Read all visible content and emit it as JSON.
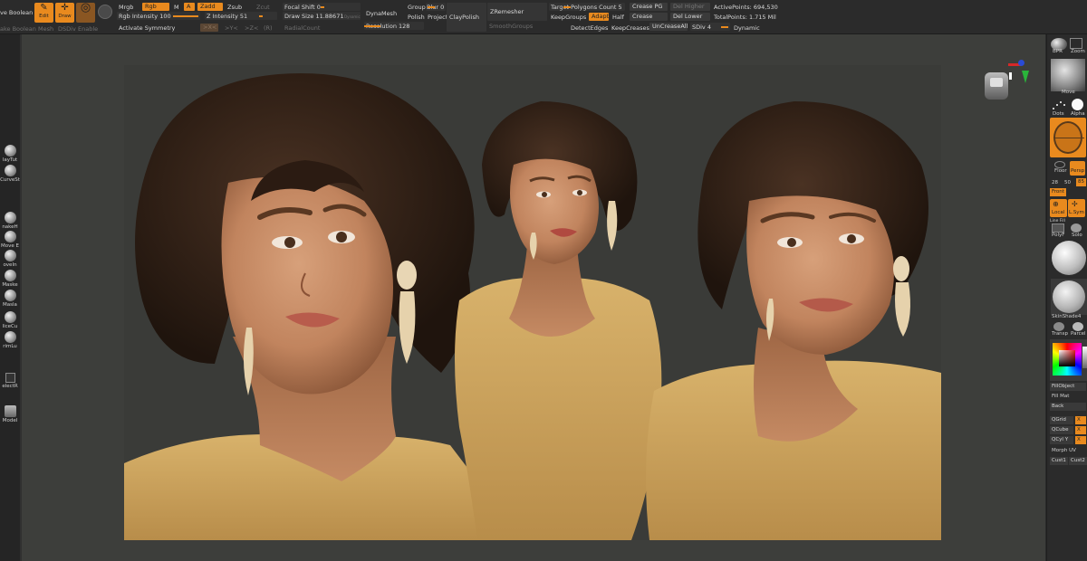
{
  "toolbar": {
    "live_boolean": "ve Boolean",
    "make_boolean_mesh": "ake Boolean Mesh",
    "dsdiv": "DSDiv",
    "enable": "Enable",
    "edit": "Edit",
    "draw": "Draw",
    "mrgb": "Mrgb",
    "rgb": "Rgb",
    "m": "M",
    "a": "A",
    "zadd": "Zadd",
    "zsub": "Zsub",
    "zcut": "Zcut",
    "rgb_intensity": "Rgb Intensity 100",
    "z_intensity": "Z Intensity 51",
    "activate_symmetry": "Activate Symmetry",
    "sym_x": ">X<",
    "sym_y": ">Y<",
    "sym_z": ">Z<",
    "sym_r": "(R)",
    "focal_shift": "Focal Shift 0",
    "draw_size": "Draw Size 11.88671",
    "dynamic_small": "Dynamic",
    "radial_count": "RadialCount",
    "dynamesh": "DynaMesh",
    "resolution": "Resolution 128",
    "groups": "Groups",
    "blur": "Blur 0",
    "polish": "Polish",
    "project": "Project",
    "claypolish": "ClayPolish",
    "zremesher": "ZRemesher",
    "smoothgroups": "SmoothGroups",
    "target_polygons": "Target Polygons Count 5",
    "keepgroups": "KeepGroups",
    "adapt": "Adapt",
    "half": "Half",
    "detectedges": "DetectEdges",
    "keepcreases": "KeepCreases",
    "crease_pg": "Crease PG",
    "crease": "Crease",
    "uncreaseall": "UnCreaseAll",
    "del_higher": "Del Higher",
    "del_lower": "Del Lower",
    "sdiv": "SDiv 4",
    "dynamic": "Dynamic",
    "active_points": "ActivePoints: 694,530",
    "total_points": "TotalPoints: 1.715 Mil"
  },
  "left_shelf": {
    "items": [
      "layTut",
      "CurveSt",
      "nakeH",
      "Move E",
      "oveIn",
      "Maske",
      "Masla",
      "liceCu",
      "rimLu",
      "electR",
      "Model"
    ]
  },
  "right_shelf": {
    "bpr": "BPR",
    "zoom": "Zoom",
    "move": "Move",
    "dots": "Dots",
    "alpha": "Alpha",
    "floor": "Floor",
    "persp": "Persp",
    "n28": "28",
    "n50": "50",
    "n85": "85",
    "front": "Front",
    "local": "Local",
    "lsym": "L.Sym",
    "line_fill": "Line Fill",
    "polyf": "PolyF",
    "solo": "Solo",
    "skinshade": "SkinShade4",
    "transp": "Transp",
    "parcel": "Parcel",
    "fillobject": "FillObject",
    "fill_mat": "Fill Mat",
    "back": "Back",
    "qgrid": "QGrid",
    "qcube": "QCube",
    "qcyl": "QCyl Y",
    "x1": "X",
    "x2": "X",
    "x3": "X",
    "morph_uv": "Morph UV",
    "cust1": "Cust1",
    "cust2": "Cust2"
  },
  "colors": {
    "accent": "#e98a1e",
    "ui_bg": "#2b2b2b",
    "canvas_bg": "#3d3e3b",
    "skin": "#c88a64",
    "hair": "#2e1f16",
    "dress": "#c9a25e"
  }
}
